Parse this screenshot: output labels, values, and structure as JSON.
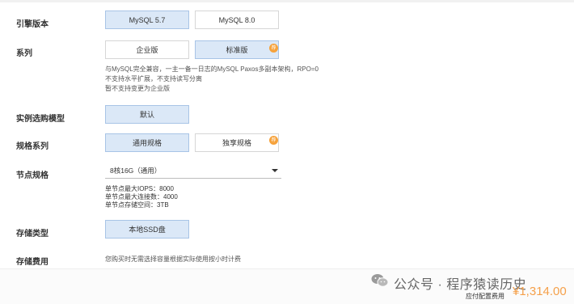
{
  "engine": {
    "label": "引擎版本",
    "options": [
      "MySQL 5.7",
      "MySQL 8.0"
    ],
    "selected": "MySQL 5.7"
  },
  "series": {
    "label": "系列",
    "options": [
      "企业版",
      "标准版"
    ],
    "selected": "标准版",
    "badge": "荐",
    "notes": [
      "与MySQL完全兼容，一主一备一日志的MySQL Paxos多副本架构，RPO=0",
      "不支持水平扩展，不支持读写分离",
      "暂不支持变更为企业版"
    ]
  },
  "model": {
    "label": "实例选购模型",
    "options": [
      "默认"
    ],
    "selected": "默认"
  },
  "spec_family": {
    "label": "规格系列",
    "options": [
      "通用规格",
      "独享规格"
    ],
    "selected": "通用规格",
    "badge": "荐"
  },
  "node_spec": {
    "label": "节点规格",
    "value": "8核16G（通用）",
    "details": [
      "单节点最大IOPS：8000",
      "单节点最大连接数：4000",
      "单节点存储空间：3TB"
    ]
  },
  "storage_type": {
    "label": "存储类型",
    "options": [
      "本地SSD盘"
    ],
    "selected": "本地SSD盘"
  },
  "storage_fee": {
    "label": "存储费用",
    "note": "您购买时无需选择容量根据实际使用按小时计费"
  },
  "footer": {
    "fee_label": "应付配置费用",
    "fee_value": "¥1,314.00",
    "watermark": "公众号 · 程序猿读历史"
  },
  "colors": {
    "selected_bg": "#dbe8f7",
    "accent_orange": "#f5a04a",
    "badge": "#f6a23b"
  }
}
